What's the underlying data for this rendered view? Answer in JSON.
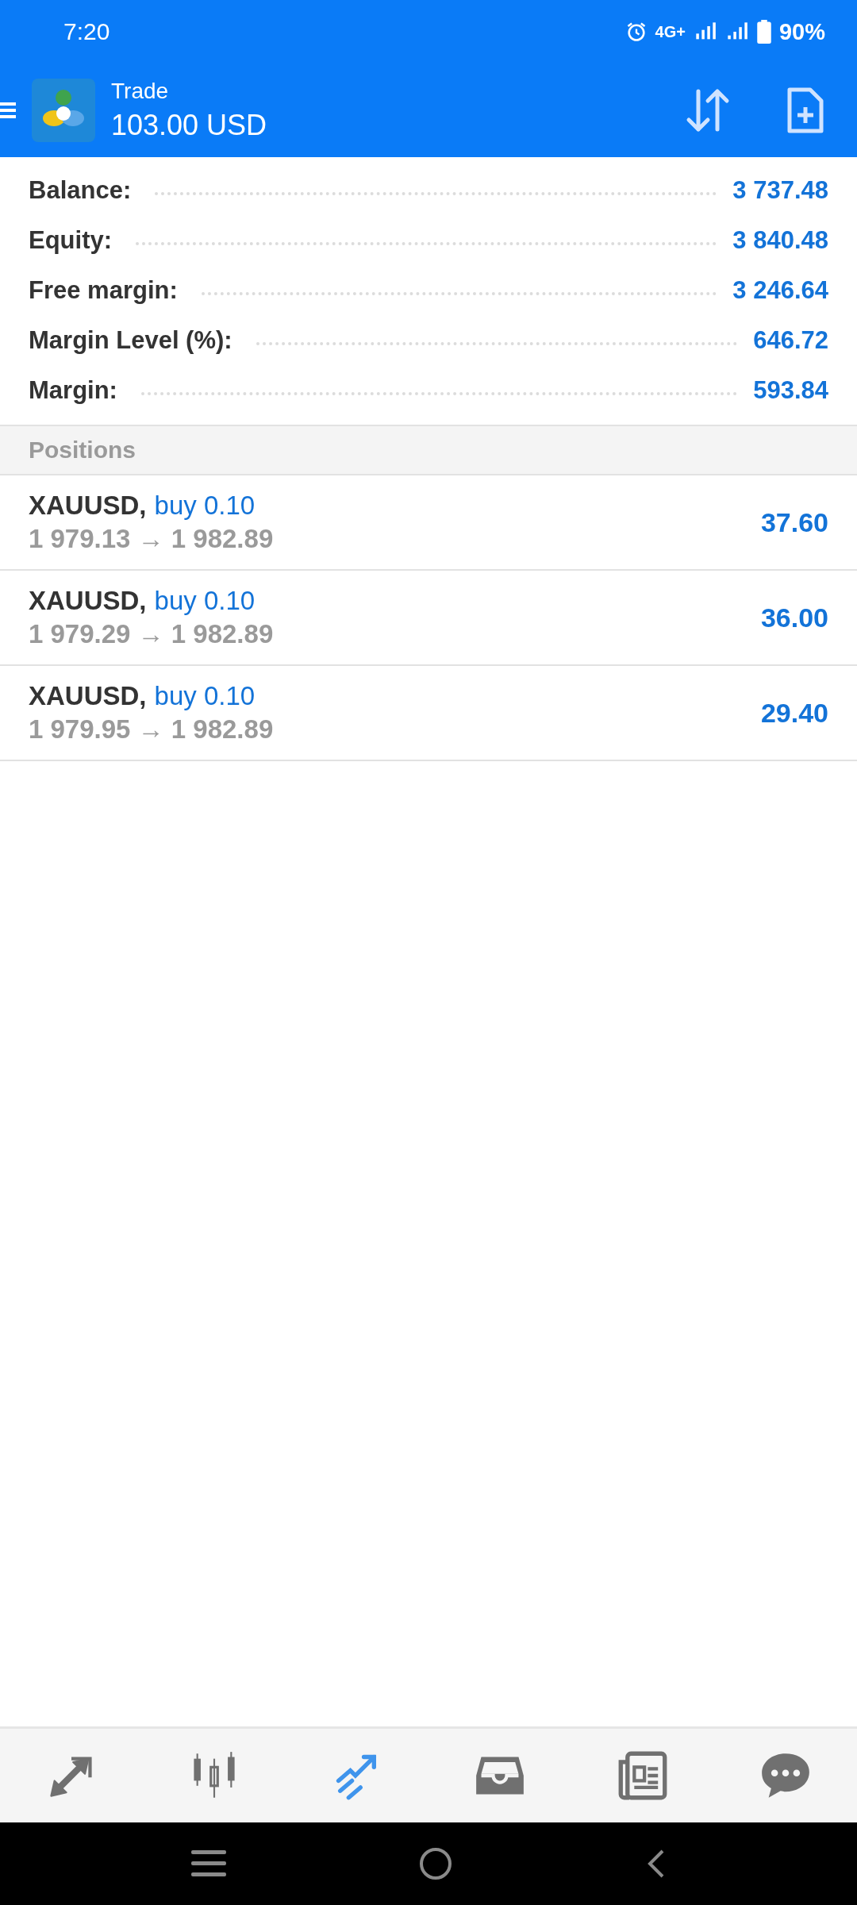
{
  "status_bar": {
    "time": "7:20",
    "network": "4G+",
    "battery": "90%"
  },
  "header": {
    "title": "Trade",
    "subtitle": "103.00 USD"
  },
  "summary": [
    {
      "label": "Balance:",
      "value": "3 737.48"
    },
    {
      "label": "Equity:",
      "value": "3 840.48"
    },
    {
      "label": "Free margin:",
      "value": "3 246.64"
    },
    {
      "label": "Margin Level (%):",
      "value": "646.72"
    },
    {
      "label": "Margin:",
      "value": "593.84"
    }
  ],
  "section_title": "Positions",
  "positions": [
    {
      "symbol": "XAUUSD,",
      "order": "buy 0.10",
      "prices": "1 979.13 → 1 982.89",
      "profit": "37.60"
    },
    {
      "symbol": "XAUUSD,",
      "order": "buy 0.10",
      "prices": "1 979.29 → 1 982.89",
      "profit": "36.00"
    },
    {
      "symbol": "XAUUSD,",
      "order": "buy 0.10",
      "prices": "1 979.95 → 1 982.89",
      "profit": "29.40"
    }
  ],
  "bottom_nav": [
    {
      "kind": "quotes",
      "selected": false
    },
    {
      "kind": "chart",
      "selected": false
    },
    {
      "kind": "trade",
      "selected": true
    },
    {
      "kind": "history",
      "selected": false
    },
    {
      "kind": "news",
      "selected": false
    },
    {
      "kind": "chat",
      "selected": false
    }
  ]
}
